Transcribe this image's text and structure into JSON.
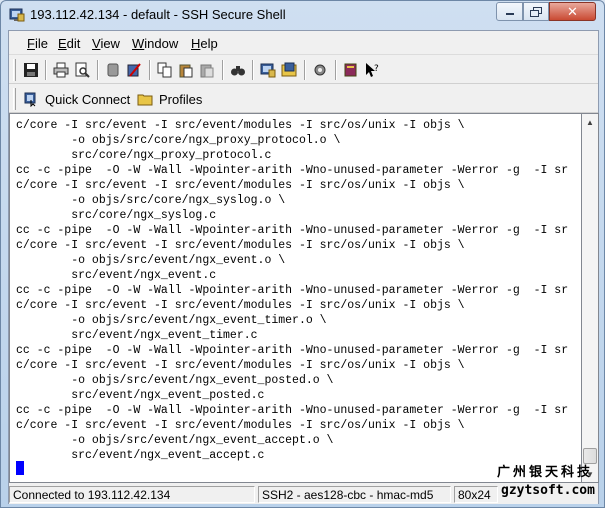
{
  "window": {
    "title": "193.112.42.134 - default - SSH Secure Shell"
  },
  "menu": {
    "items": [
      {
        "label_first": "F",
        "label_rest": "ile"
      },
      {
        "label_first": "E",
        "label_rest": "dit"
      },
      {
        "label_first": "V",
        "label_rest": "iew"
      },
      {
        "label_first": "W",
        "label_rest": "indow"
      },
      {
        "label_first": "H",
        "label_rest": "elp"
      }
    ]
  },
  "toolbar": {
    "buttons": [
      "save-icon",
      "print-icon",
      "print-preview-icon",
      "disconnect-icon",
      "settings-icon",
      "copy-icon",
      "paste-icon",
      "paste-disabled-icon",
      "find-icon",
      "new-terminal-icon",
      "new-file-transfer-icon",
      "profile-settings-icon",
      "help-book-icon",
      "whats-this-icon"
    ]
  },
  "quickbar": {
    "quick_connect": "Quick Connect",
    "profiles": "Profiles"
  },
  "terminal": {
    "lines": [
      "c/core -I src/event -I src/event/modules -I src/os/unix -I objs \\",
      "        -o objs/src/core/ngx_proxy_protocol.o \\",
      "        src/core/ngx_proxy_protocol.c",
      "cc -c -pipe  -O -W -Wall -Wpointer-arith -Wno-unused-parameter -Werror -g  -I sr",
      "c/core -I src/event -I src/event/modules -I src/os/unix -I objs \\",
      "        -o objs/src/core/ngx_syslog.o \\",
      "        src/core/ngx_syslog.c",
      "cc -c -pipe  -O -W -Wall -Wpointer-arith -Wno-unused-parameter -Werror -g  -I sr",
      "c/core -I src/event -I src/event/modules -I src/os/unix -I objs \\",
      "        -o objs/src/event/ngx_event.o \\",
      "        src/event/ngx_event.c",
      "cc -c -pipe  -O -W -Wall -Wpointer-arith -Wno-unused-parameter -Werror -g  -I sr",
      "c/core -I src/event -I src/event/modules -I src/os/unix -I objs \\",
      "        -o objs/src/event/ngx_event_timer.o \\",
      "        src/event/ngx_event_timer.c",
      "cc -c -pipe  -O -W -Wall -Wpointer-arith -Wno-unused-parameter -Werror -g  -I sr",
      "c/core -I src/event -I src/event/modules -I src/os/unix -I objs \\",
      "        -o objs/src/event/ngx_event_posted.o \\",
      "        src/event/ngx_event_posted.c",
      "cc -c -pipe  -O -W -Wall -Wpointer-arith -Wno-unused-parameter -Werror -g  -I sr",
      "c/core -I src/event -I src/event/modules -I src/os/unix -I objs \\",
      "        -o objs/src/event/ngx_event_accept.o \\",
      "        src/event/ngx_event_accept.c"
    ]
  },
  "status": {
    "connection": "Connected to 193.112.42.134",
    "cipher": "SSH2 - aes128-cbc - hmac-md5",
    "size": "80x24"
  },
  "watermark": {
    "cn": "广州银天科技",
    "en": "gzytsoft.com"
  },
  "colors": {
    "cursor": "#0000ff",
    "close_button": "#c94a33"
  }
}
